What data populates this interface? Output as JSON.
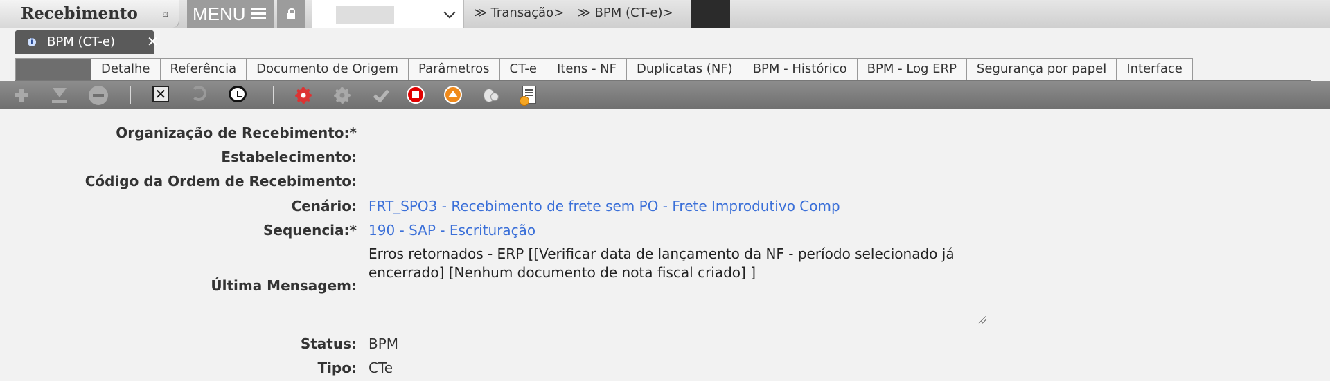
{
  "app": {
    "title": "Recebimento",
    "menu_label": "MENU"
  },
  "breadcrumb": [
    "≫ Transação>",
    "≫ BPM (CT-e)>"
  ],
  "open_tab": {
    "label": "BPM (CT-e)",
    "close": "✕"
  },
  "subtabs": [
    "Detalhe",
    "Referência",
    "Documento de Origem",
    "Parâmetros",
    "CT-e",
    "Itens - NF",
    "Duplicatas (NF)",
    "BPM - Histórico",
    "BPM - Log ERP",
    "Segurança por papel",
    "Interface"
  ],
  "toolbar_icons": [
    "plus-icon",
    "download-icon",
    "minus-icon",
    "close-box-icon",
    "undo-icon",
    "clock-icon",
    "red-gear-icon",
    "gray-gear-icon",
    "check-icon",
    "stop-icon",
    "up-arrow-icon",
    "coins-icon",
    "report-icon"
  ],
  "form": {
    "org_label": "Organização de Recebimento:*",
    "estab_label": "Estabelecimento:",
    "ordem_label": "Código da Ordem de Recebimento:",
    "cenario_label": "Cenário:",
    "cenario_value": "FRT_SPO3 - Recebimento de frete sem PO - Frete Improdutivo Comp",
    "sequencia_label": "Sequencia:*",
    "sequencia_value": "190 - SAP - Escrituração",
    "msg_label": "Última Mensagem:",
    "msg_value": "Erros retornados - ERP [[Verificar data de lançamento da NF - período selecionado já encerrado] [Nenhum documento de nota fiscal criado] ]",
    "status_label": "Status:",
    "status_value": "BPM",
    "tipo_label": "Tipo:",
    "tipo_value": "CTe"
  },
  "colors": {
    "link": "#3a6fd8",
    "toolbar": "#7a7a7a",
    "active_tab": "#6e6e6e"
  }
}
